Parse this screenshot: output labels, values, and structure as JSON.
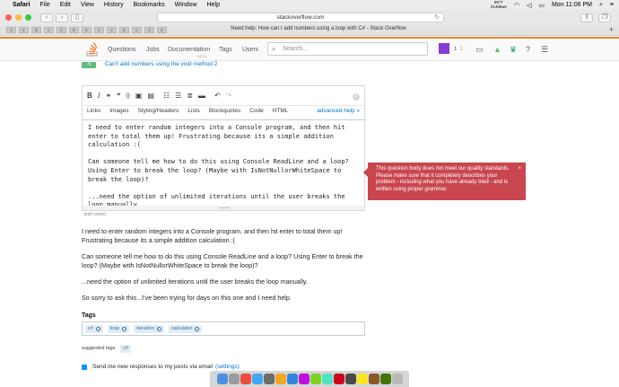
{
  "menubar": {
    "app": "Safari",
    "items": [
      "File",
      "Edit",
      "View",
      "History",
      "Bookmarks",
      "Window",
      "Help"
    ],
    "temp_top": "85°F",
    "temp_bottom": "2149kwe",
    "clock": "Mon 11:06 PM"
  },
  "browser": {
    "address": "stackoverflow.com",
    "tab_title": "Need help: How can I add numbers using a loop with C# - Stack Overflow",
    "favorites": [
      "S",
      "E",
      "B",
      "C",
      "E",
      "B",
      "E",
      "S",
      "C",
      "B",
      "C",
      "S",
      "E"
    ]
  },
  "header": {
    "nav": [
      "Questions",
      "Jobs",
      "Documentation",
      "Tags",
      "Users"
    ],
    "beta": "BETA",
    "search_placeholder": "Search...",
    "rep": "1",
    "badge": "1"
  },
  "related": {
    "score": "-5",
    "link": "Can't add numbers using the void method 2"
  },
  "editor": {
    "tabs": [
      "Links",
      "Images",
      "Styling/Headers",
      "Lists",
      "Blockquotes",
      "Code",
      "HTML"
    ],
    "advanced": "advanced help »",
    "text": "I need to enter random integers into a Console program, and then hit enter to total them up! Frustrating because its a simple addition calculation :(\n\nCan someone tell me how to do this using Console ReadLine and a loop? Using Enter to break the loop? (Maybe with IsNotNullorWhiteSpace to break the loop)?\n\n...need the option of unlimited iterations until the user breaks the loop manually.\n\nSo sorry to ask this...I've been trying for days on this one and I need help.",
    "draft": "draft saved"
  },
  "popup": {
    "message": "This question body does not meet our quality standards. Please make sure that it completely describes your problem - including what you have already tried - and is written using proper grammar.",
    "close": "×"
  },
  "preview": {
    "paragraphs": [
      "I need to enter random integers into a Console program, and then hit enter to total them up! Frustrating because its a simple addition calculation :(",
      "Can someone tell me how to do this using Console ReadLine and a loop? Using Enter to break the loop? (Maybe with IsNotNullorWhiteSpace to break the loop)?",
      "...need the option of unlimited iterations until the user breaks the loop manually.",
      "So sorry to ask this...I've been trying for days on this one and I need help."
    ]
  },
  "tags": {
    "label": "Tags",
    "items": [
      "c#",
      "loop",
      "iteration",
      "calculator"
    ],
    "suggested_label": "suggested tags:",
    "suggested": "c#"
  },
  "notify": {
    "text": "Send me new responses to my posts via email",
    "link": "(settings)"
  },
  "colors": {
    "accent": "#f48024",
    "link": "#0077cc",
    "error": "#c9464f",
    "tag_bg": "#e1ecf4"
  }
}
